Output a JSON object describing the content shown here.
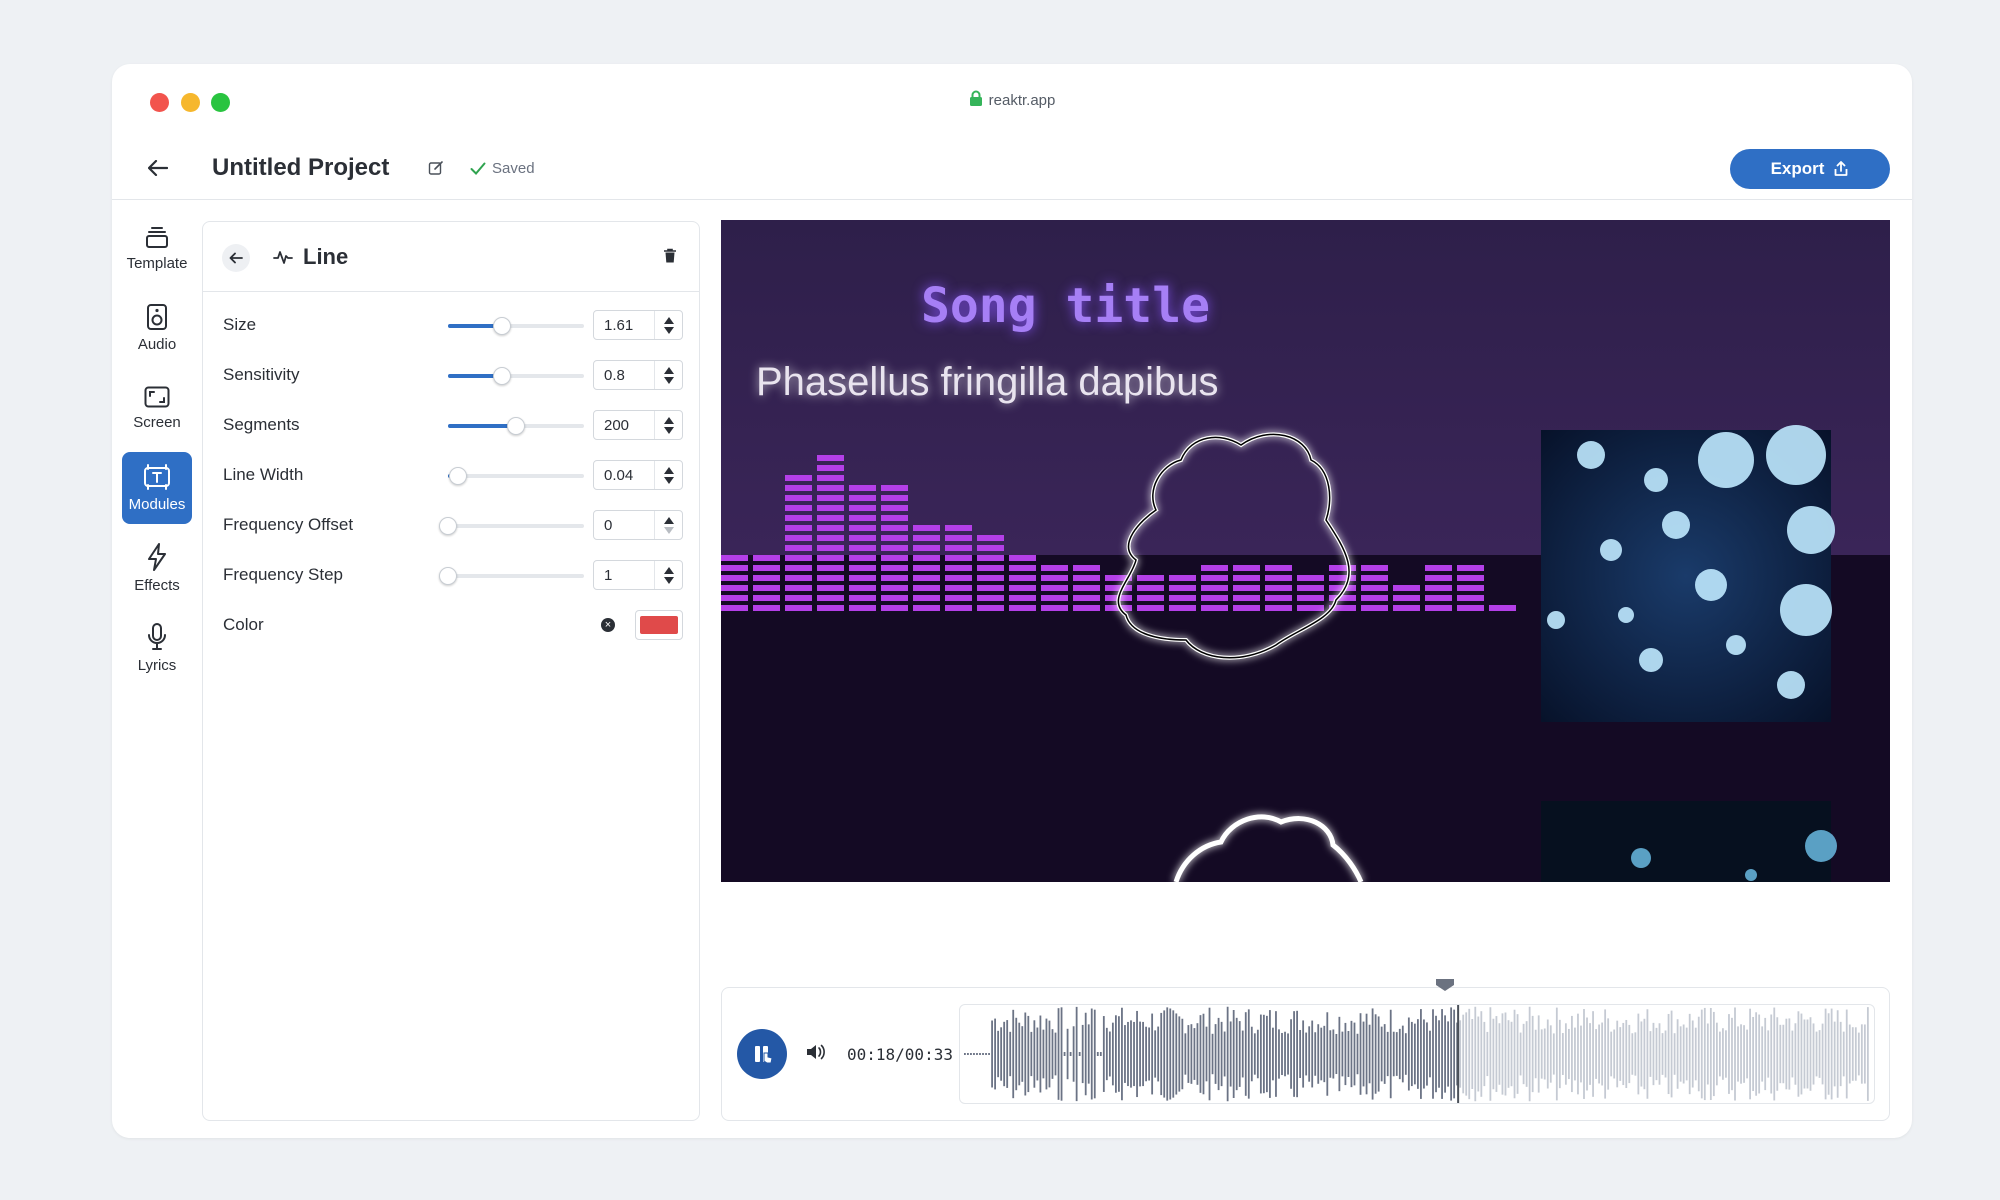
{
  "browser": {
    "url": "reaktr.app"
  },
  "header": {
    "title": "Untitled Project",
    "saved_label": "Saved",
    "export_label": "Export"
  },
  "rail": [
    {
      "label": "Template",
      "icon": "layers-icon",
      "active": false
    },
    {
      "label": "Audio",
      "icon": "speaker-icon",
      "active": false
    },
    {
      "label": "Screen",
      "icon": "screen-icon",
      "active": false
    },
    {
      "label": "Modules",
      "icon": "modules-icon",
      "active": true
    },
    {
      "label": "Effects",
      "icon": "lightning-icon",
      "active": false
    },
    {
      "label": "Lyrics",
      "icon": "microphone-icon",
      "active": false
    }
  ],
  "panel": {
    "title": "Line",
    "controls": [
      {
        "label": "Size",
        "value": "1.61",
        "fill": 0.4
      },
      {
        "label": "Sensitivity",
        "value": "0.8",
        "fill": 0.4
      },
      {
        "label": "Segments",
        "value": "200",
        "fill": 0.5
      },
      {
        "label": "Line Width",
        "value": "0.04",
        "fill": 0.07
      },
      {
        "label": "Frequency Offset",
        "value": "0",
        "fill": 0.0
      },
      {
        "label": "Frequency Step",
        "value": "1",
        "fill": 0.0
      }
    ],
    "color_label": "Color",
    "color_value": "#e04a4a"
  },
  "preview": {
    "song_title": "Song title",
    "lyric": "Phasellus fringilla dapibus"
  },
  "player": {
    "time": "00:18/00:33",
    "progress": 0.545
  },
  "colors": {
    "accent": "#2f6fc5",
    "bars": "#b43fe8"
  }
}
